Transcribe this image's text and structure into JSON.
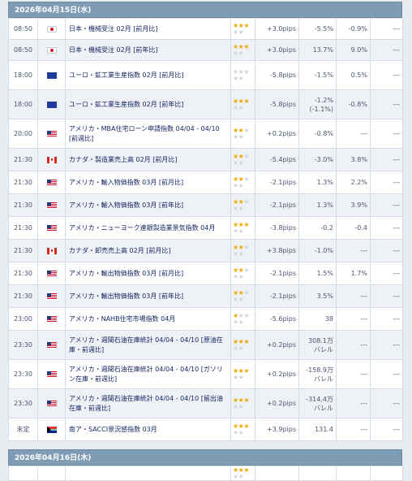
{
  "days": [
    {
      "header": "2026年04月15日(水)",
      "rows": [
        {
          "time": "08:50",
          "flag": "jp-flag-icon",
          "name": "日本・機械受注 02月 [前月比]",
          "stars": 3,
          "prev": "+3.0pips",
          "forecast": "-5.5%",
          "result": "-0.9%",
          "extra": "---"
        },
        {
          "time": "08:50",
          "flag": "jp-flag-icon",
          "name": "日本・機械受注 02月 [前年比]",
          "stars": 3,
          "prev": "+3.0pips",
          "forecast": "13.7%",
          "result": "9.0%",
          "extra": "---"
        },
        {
          "time": "18:00",
          "flag": "eu-flag-icon",
          "name": "ユーロ・鉱工業生産指数 02月 [前月比]",
          "stars": 0,
          "prev": "-5.8pips",
          "forecast": "-1.5%",
          "result": "0.5%",
          "extra": "---"
        },
        {
          "time": "18:00",
          "flag": "eu-flag-icon",
          "name": "ユーロ・鉱工業生産指数 02月 [前年比]",
          "stars": 3,
          "prev": "-5.8pips",
          "forecast": "-1.2%",
          "forecast2": "(-1.1%)",
          "result": "-0.8%",
          "extra": "---"
        },
        {
          "time": "20:00",
          "flag": "us-flag-icon",
          "name": "アメリカ・MBA住宅ローン申請指数 04/04 - 04/10 [前週比]",
          "stars": 2,
          "prev": "+0.2pips",
          "forecast": "-0.8%",
          "result": "---",
          "extra": "---"
        },
        {
          "time": "21:30",
          "flag": "ca-flag-icon",
          "name": "カナダ・製造業売上高 02月 [前月比]",
          "stars": 2,
          "prev": "-5.4pips",
          "forecast": "-3.0%",
          "result": "3.8%",
          "extra": "---"
        },
        {
          "time": "21:30",
          "flag": "us-flag-icon",
          "name": "アメリカ・輸入物価指数 03月 [前月比]",
          "stars": 2,
          "prev": "-2.1pips",
          "forecast": "1.3%",
          "result": "2.2%",
          "extra": "---"
        },
        {
          "time": "21:30",
          "flag": "us-flag-icon",
          "name": "アメリカ・輸入物価指数 03月 [前年比]",
          "stars": 2,
          "prev": "-2.1pips",
          "forecast": "1.3%",
          "result": "3.9%",
          "extra": "---"
        },
        {
          "time": "21:30",
          "flag": "us-flag-icon",
          "name": "アメリカ・ニューヨーク連銀製造業景気指数 04月",
          "stars": 3,
          "prev": "-3.8pips",
          "forecast": "-0.2",
          "result": "-0.4",
          "extra": "---"
        },
        {
          "time": "21:30",
          "flag": "ca-flag-icon",
          "name": "カナダ・卸売売上高 02月 [前月比]",
          "stars": 2,
          "prev": "+3.8pips",
          "forecast": "-1.0%",
          "result": "---",
          "extra": "---"
        },
        {
          "time": "21:30",
          "flag": "us-flag-icon",
          "name": "アメリカ・輸出物価指数 03月 [前月比]",
          "stars": 2,
          "prev": "-2.1pips",
          "forecast": "1.5%",
          "result": "1.7%",
          "extra": "---"
        },
        {
          "time": "21:30",
          "flag": "us-flag-icon",
          "name": "アメリカ・輸出物価指数 03月 [前年比]",
          "stars": 2,
          "prev": "-2.1pips",
          "forecast": "3.5%",
          "result": "---",
          "extra": "---"
        },
        {
          "time": "23:00",
          "flag": "us-flag-icon",
          "name": "アメリカ・NAHB住宅市場指数 04月",
          "stars": 1,
          "prev": "-5.6pips",
          "forecast": "38",
          "result": "---",
          "extra": "---"
        },
        {
          "time": "23:30",
          "flag": "us-flag-icon",
          "name": "アメリカ・週間石油在庫統計 04/04 - 04/10 [原油在庫・前週比]",
          "stars": 3,
          "prev": "+0.2pips",
          "forecast": "308.1万",
          "forecast2": "バレル",
          "result": "---",
          "extra": "---"
        },
        {
          "time": "23:30",
          "flag": "us-flag-icon",
          "name": "アメリカ・週間石油在庫統計 04/04 - 04/10 [ガソリン在庫・前週比]",
          "stars": 3,
          "prev": "+0.2pips",
          "forecast": "-158.9万",
          "forecast2": "バレル",
          "result": "---",
          "extra": "---"
        },
        {
          "time": "23:30",
          "flag": "us-flag-icon",
          "name": "アメリカ・週間石油在庫統計 04/04 - 04/10 [留出油在庫・前週比]",
          "stars": 3,
          "prev": "+0.2pips",
          "forecast": "-314.4万",
          "forecast2": "バレル",
          "result": "---",
          "extra": "---"
        },
        {
          "time": "未定",
          "flag": "za-flag-icon",
          "name": "南ア・SACCI景況感指数 03月",
          "stars": 3,
          "prev": "+3.9pips",
          "forecast": "131.4",
          "result": "---",
          "extra": "---"
        }
      ]
    },
    {
      "header": "2026年04月16日(木)",
      "rows": [
        {
          "time": "",
          "flag": "",
          "name": "",
          "stars": 3,
          "prev": "",
          "forecast": "",
          "result": "",
          "extra": ""
        }
      ]
    }
  ],
  "colors": {
    "star_on": "#f0a500",
    "star_off": "#d0d5dc",
    "header_bg": "#7f9cb4",
    "alt_row": "#eef2f6"
  }
}
